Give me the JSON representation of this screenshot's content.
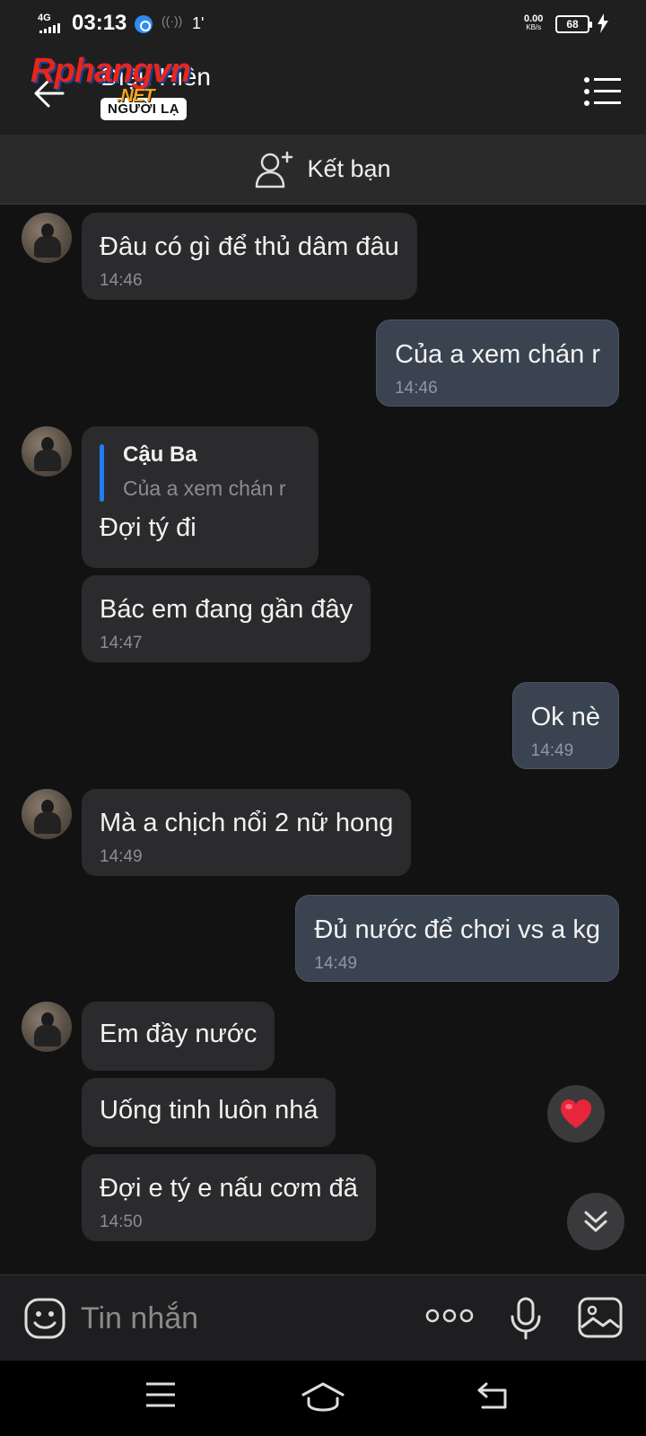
{
  "status_bar": {
    "network": "4G",
    "time": "03:13",
    "misc": "1'",
    "speed_value": "0.00",
    "speed_unit": "KB/s",
    "battery": "68"
  },
  "header": {
    "watermark": "Rphang",
    "watermark_suffix": "vn",
    "watermark_net": ".NET",
    "contact_name": "Diệu Hiền",
    "badge": "NGƯỜI LẠ"
  },
  "add_friend": {
    "label": "Kết bạn"
  },
  "messages": [
    {
      "dir": "in",
      "text": "Đâu có gì để thủ dâm đâu",
      "time": "14:46"
    },
    {
      "dir": "out",
      "text": "Của a xem chán r",
      "time": "14:46"
    },
    {
      "dir": "in",
      "quote_name": "Cậu Ba",
      "quote_text": "Của a xem chán r",
      "text": "Đợi tý đi"
    },
    {
      "dir": "in",
      "text": "Bác em đang gần đây",
      "time": "14:47"
    },
    {
      "dir": "out",
      "text": "Ok nè",
      "time": "14:49"
    },
    {
      "dir": "in",
      "text": "Mà a chịch nổi 2 nữ hong",
      "time": "14:49"
    },
    {
      "dir": "out",
      "text": "Đủ nước để chơi vs a kg",
      "time": "14:49"
    },
    {
      "dir": "in",
      "text": "Em đầy nước"
    },
    {
      "dir": "in",
      "text": "Uống tinh luôn nhá"
    },
    {
      "dir": "in",
      "text": "Đợi e tý e nấu cơm đã",
      "time": "14:50"
    }
  ],
  "input": {
    "placeholder": "Tin nhắn"
  },
  "colors": {
    "incoming_bubble": "#2b2b2d",
    "outgoing_bubble": "#3a4350",
    "quote_bar": "#1f7ef5",
    "heart": "#e8263b"
  }
}
